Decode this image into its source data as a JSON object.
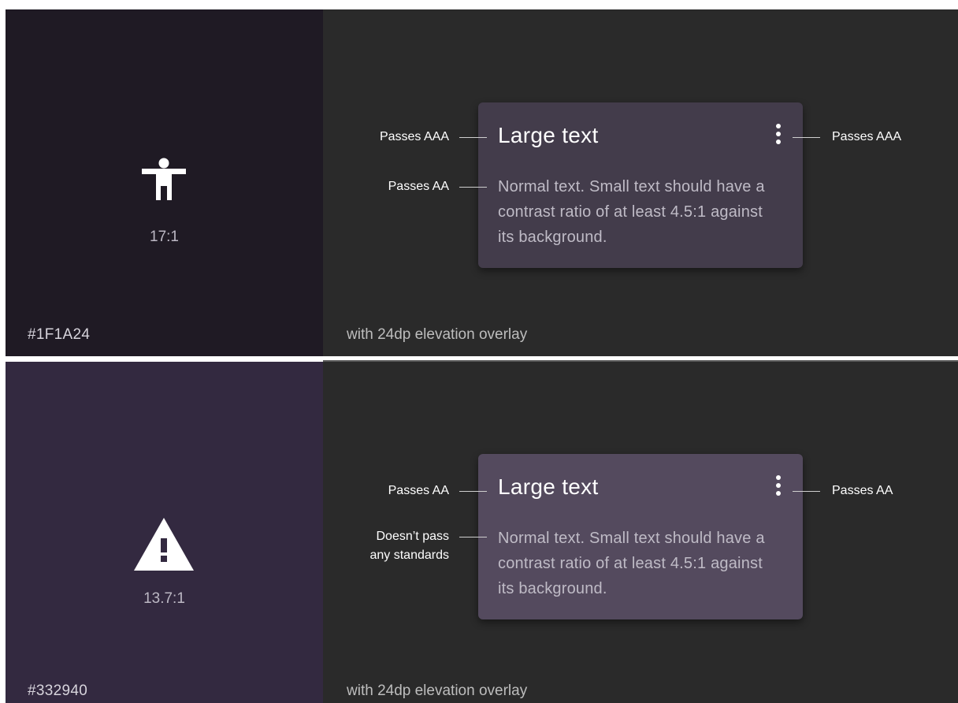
{
  "rows": [
    {
      "swatch_color": "#1F1A24",
      "hex_label": "#1F1A24",
      "ratio": "17:1",
      "icon": "accessibility-person-icon",
      "overlay_label": "with 24dp elevation overlay",
      "card_color": "#433C4B",
      "large_text": "Large text",
      "normal_text": "Normal text. Small text should have a contrast ratio of at least 4.5:1 against its background.",
      "large_annotation": "Passes AAA",
      "normal_annotation": "Passes AA",
      "icon_annotation": "Passes AAA"
    },
    {
      "swatch_color": "#332940",
      "hex_label": "#332940",
      "ratio": "13.7:1",
      "icon": "warning-triangle-icon",
      "overlay_label": "with 24dp elevation overlay",
      "card_color": "#544A5E",
      "large_text": "Large text",
      "normal_text": "Normal text. Small text should have a contrast ratio of at least 4.5:1 against its background.",
      "large_annotation": "Passes AA",
      "normal_annotation_line1": "Doesn’t pass",
      "normal_annotation_line2": "any standards",
      "icon_annotation": "Passes AA"
    }
  ],
  "colors": {
    "panel_background": "#2A2A2A",
    "divider": "#5A5A5A"
  }
}
